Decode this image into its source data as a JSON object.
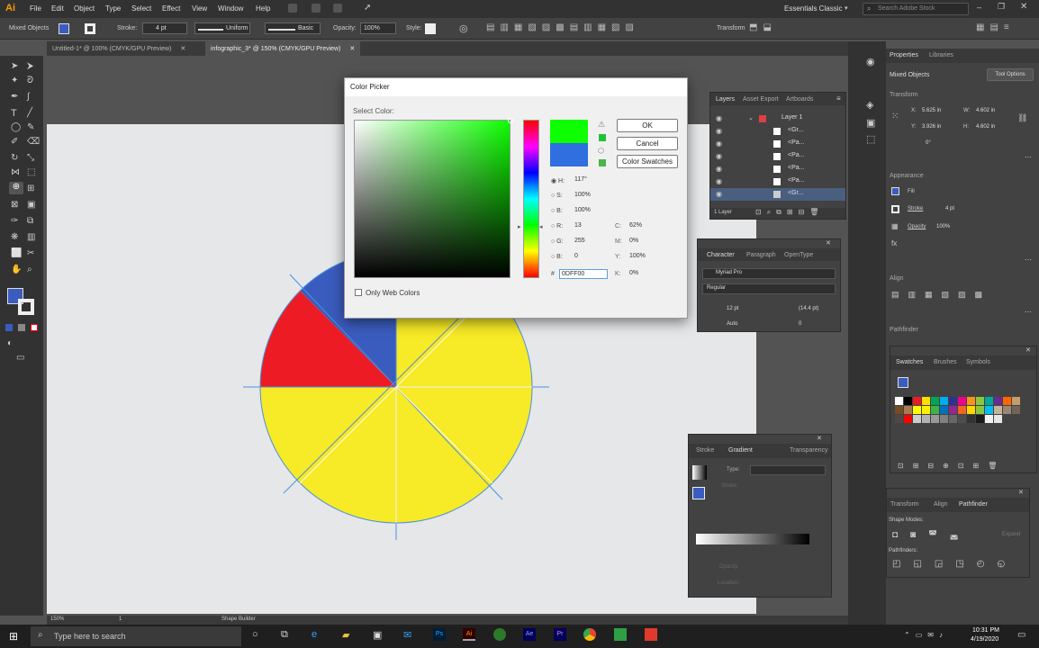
{
  "menubar": {
    "app_logo": "Ai",
    "items": [
      "File",
      "Edit",
      "Object",
      "Type",
      "Select",
      "Effect",
      "View",
      "Window",
      "Help"
    ],
    "workspace": "Essentials Classic",
    "search_placeholder": "Search Adobe Stock"
  },
  "control_bar": {
    "selection": "Mixed Objects",
    "stroke_label": "Stroke:",
    "stroke_value": "4 pt",
    "profile": "Uniform",
    "brush": "Basic",
    "opacity_label": "Opacity:",
    "opacity_value": "100%",
    "style_label": "Style:",
    "transform": "Transform"
  },
  "doc_tabs": [
    {
      "label": "Untitled-1* @ 100% (CMYK/GPU Preview)"
    },
    {
      "label": "infographic_3* @ 150% (CMYK/GPU Preview)"
    }
  ],
  "color_picker": {
    "title": "Color Picker",
    "select_label": "Select Color:",
    "ok": "OK",
    "cancel": "Cancel",
    "swatches": "Color Swatches",
    "fields": {
      "H": "117°",
      "S": "100%",
      "B": "100%",
      "R": "13",
      "G": "255",
      "B2": "0",
      "C": "62%",
      "M": "0%",
      "Y": "100%",
      "K": "0%",
      "hex": "0DFF00"
    },
    "only_web": "Only Web Colors",
    "new_color": "#0dff00",
    "old_color": "#2f6fe0"
  },
  "layers_panel": {
    "tabs": [
      "Layers",
      "Asset Export",
      "Artboards"
    ],
    "layer_name": "Layer 1",
    "rows": [
      "<Gr...",
      "<Pa...",
      "<Pa...",
      "<Pa...",
      "<Pa...",
      "<Gr..."
    ],
    "footer": "1 Layer"
  },
  "character_panel": {
    "tabs": [
      "Character",
      "Paragraph",
      "OpenType"
    ],
    "font": "Myriad Pro",
    "style": "Regular",
    "size": "12 pt",
    "leading": "(14.4 pt)",
    "kerning": "Auto",
    "tracking": "0"
  },
  "gradient_panel": {
    "tabs": [
      "Stroke",
      "Gradient",
      "Transparency"
    ],
    "type_label": "Type:",
    "stroke_label": "Stroke:",
    "opacity_label": "Opacity:",
    "location_label": "Location:"
  },
  "properties": {
    "tabs": [
      "Properties",
      "Libraries"
    ],
    "selection": "Mixed Objects",
    "tool_options": "Tool Options",
    "transform_label": "Transform",
    "x": "5.625 in",
    "y": "3.926 in",
    "w": "4.602 in",
    "h": "4.602 in",
    "angle": "0°",
    "appearance_label": "Appearance",
    "fill_label": "Fill",
    "stroke_label": "Stroke",
    "stroke_value": "4 pt",
    "opacity_label": "Opacity",
    "opacity_value": "100%",
    "align_label": "Align",
    "pathfinder_label": "Pathfinder"
  },
  "swatches_panel": {
    "tabs": [
      "Swatches",
      "Brushes",
      "Symbols"
    ],
    "colors": [
      "#ffffff",
      "#000000",
      "#ed1c24",
      "#ffde00",
      "#00a651",
      "#00aeef",
      "#2e3192",
      "#ec008c",
      "#f7941d",
      "#8dc63f",
      "#00a99d",
      "#662d91",
      "#ff6600",
      "#c69c6d",
      "#754c24",
      "#a67c52",
      "#ffff00",
      "#fff200",
      "#39b54a",
      "#0072bc",
      "#92278f",
      "#f26522",
      "#ffd700",
      "#8cc63f",
      "#00bff3",
      "#c7b299",
      "#998675",
      "#736357",
      "#534741",
      "#ff0000",
      "#cccccc",
      "#b3b3b3",
      "#999999",
      "#808080",
      "#666666",
      "#4d4d4d",
      "#333333",
      "#1a1a1a",
      "#f2f2f2",
      "#e6e6e6"
    ]
  },
  "pathfinder_panel": {
    "tabs": [
      "Transform",
      "Align",
      "Pathfinder"
    ],
    "shape_modes": "Shape Modes:",
    "pathfinders": "Pathfinders:",
    "expand": "Expand"
  },
  "status": {
    "zoom": "150%",
    "artboard": "1",
    "tool": "Shape Builder"
  },
  "taskbar": {
    "search_placeholder": "Type here to search",
    "time": "10:31 PM",
    "date": "4/19/2020"
  },
  "art_colors": {
    "yellow": "#f7ea26",
    "red": "#ed1c24",
    "blue": "#3b5cbf",
    "guide": "#4a90e2"
  }
}
